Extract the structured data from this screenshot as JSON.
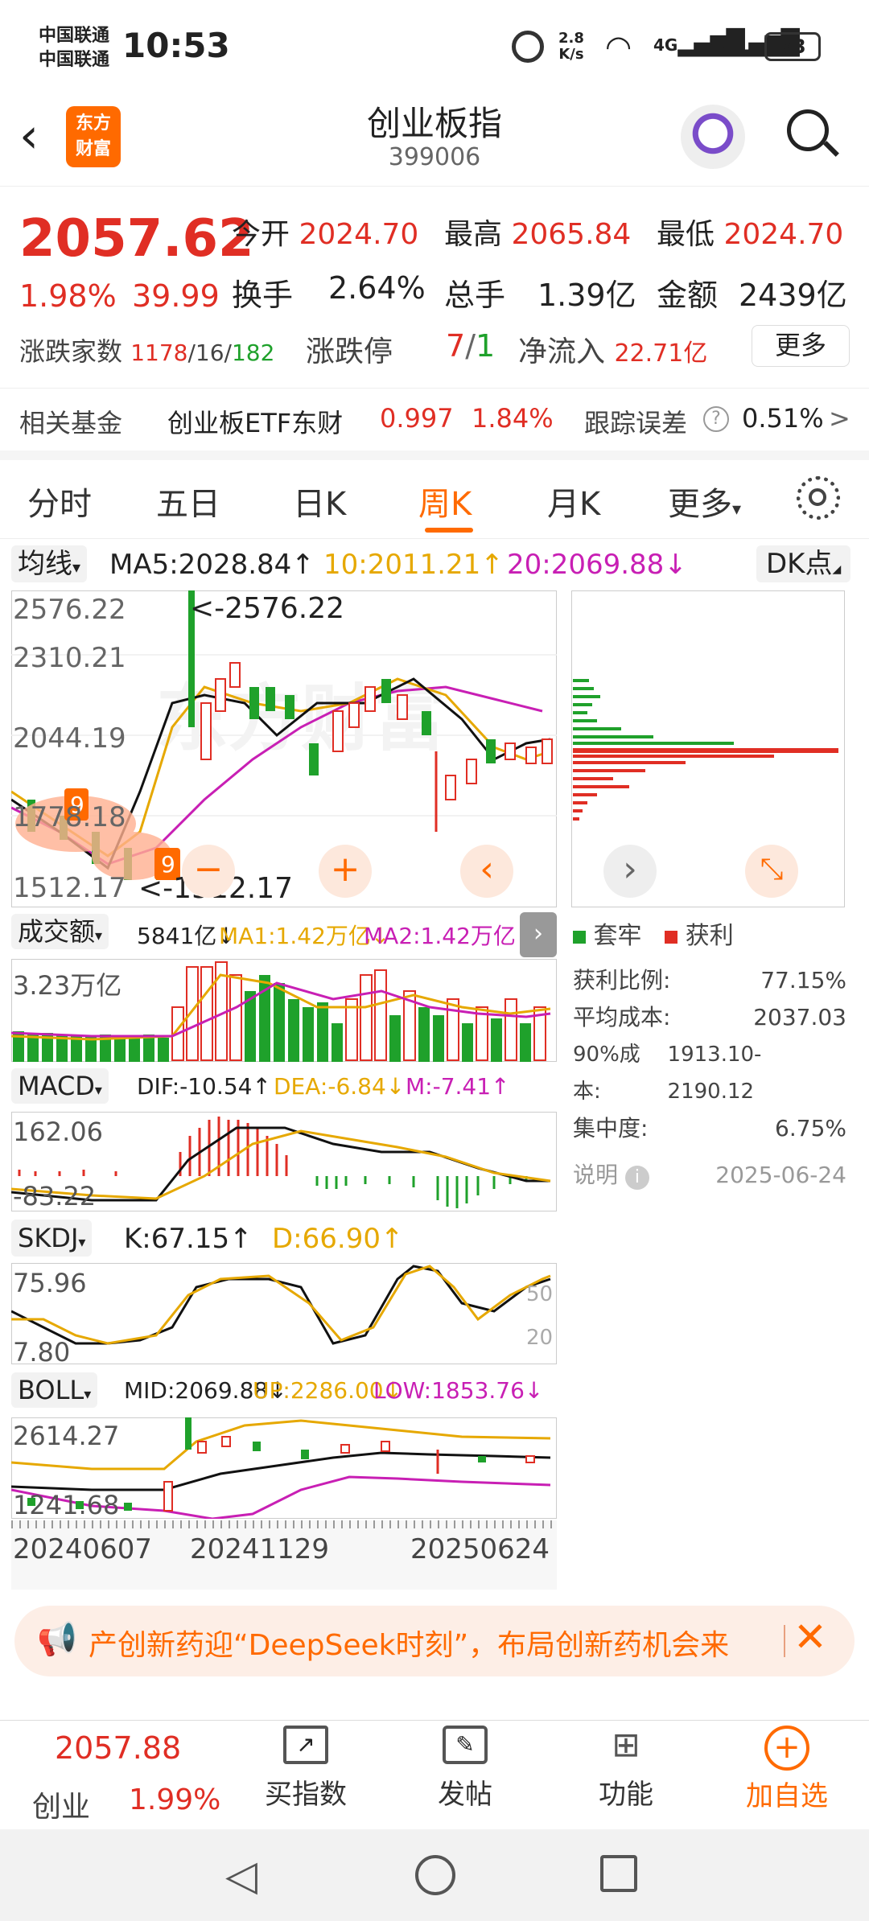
{
  "status": {
    "carrier1": "中国联通",
    "carrier2": "中国联通",
    "time": "10:53",
    "speed": "2.8",
    "speed_unit": "K/s",
    "net1": "4G",
    "net2": "4G",
    "battery": "73"
  },
  "header": {
    "title": "创业板指",
    "code": "399006",
    "logo_line1": "东方",
    "logo_line2": "财富"
  },
  "quote": {
    "price": "2057.62",
    "pct": "1.98%",
    "chg": "39.99",
    "open_label": "今开",
    "open": "2024.70",
    "high_label": "最高",
    "high": "2065.84",
    "low_label": "最低",
    "low": "2024.70",
    "turnover_label": "换手",
    "turnover": "2.64%",
    "vol_label": "总手",
    "vol": "1.39亿",
    "amount_label": "金额",
    "amount": "2439亿",
    "adv_label": "涨跌家数",
    "adv_up": "1178",
    "adv_flat": "16",
    "adv_down": "182",
    "sep": "/",
    "limit_label": "涨跌停",
    "limit_up": "7",
    "limit_down": "1",
    "inflow_label": "净流入",
    "inflow": "22.71亿",
    "more": "更多"
  },
  "fund": {
    "label": "相关基金",
    "name": "创业板ETF东财",
    "price": "0.997",
    "pct": "1.84%",
    "err_label": "跟踪误差",
    "err": "0.51%",
    "arrow": ">"
  },
  "tabs": [
    {
      "label": "分时"
    },
    {
      "label": "五日"
    },
    {
      "label": "日K"
    },
    {
      "label": "周K"
    },
    {
      "label": "月K"
    },
    {
      "label": "更多"
    }
  ],
  "ma": {
    "sel": "均线",
    "ma5": "MA5:2028.84↑",
    "ma10": "10:2011.21↑",
    "ma20": "20:2069.88↓",
    "dk": "DK点"
  },
  "kchart": {
    "y1": "2576.22",
    "y2": "2310.21",
    "y3": "2044.19",
    "y4": "1778.18",
    "y5": "1512.17",
    "hi_note": "<-2576.22",
    "lo_note": "<-1512.17"
  },
  "chips": {
    "tab1": "套牢",
    "tab2": "获利",
    "r1_label": "获利比例:",
    "r1": "77.15%",
    "r2_label": "平均成本:",
    "r2": "2037.03",
    "r3_label": "90%成本:",
    "r3": "1913.10-2190.12",
    "r4_label": "集中度:",
    "r4": "6.75%",
    "note_label": "说明",
    "date": "2025-06-24"
  },
  "vol": {
    "sel": "成交额",
    "v": "5841亿↓",
    "ma1": "MA1:1.42万亿↓",
    "ma2": "MA2:1.42万亿↓",
    "y": "3.23万亿"
  },
  "macd": {
    "sel": "MACD",
    "dif": "DIF:-10.54↑",
    "dea": "DEA:-6.84↓",
    "m": "M:-7.41↑",
    "y1": "162.06",
    "y2": "-83.22"
  },
  "skdj": {
    "sel": "SKDJ",
    "k": "K:67.15↑",
    "d": "D:66.90↑",
    "y1": "75.96",
    "y2": "7.80",
    "r50": "50",
    "r20": "20"
  },
  "boll": {
    "sel": "BOLL",
    "mid": "MID:2069.88↓",
    "up": "UP:2286.00↓",
    "low": "LOW:1853.76↓",
    "y1": "2614.27",
    "y2": "1241.68"
  },
  "xaxis": {
    "d1": "20240607",
    "d2": "20241129",
    "d3": "20250624"
  },
  "banner": {
    "text": "产创新药迎“DeepSeek时刻”，布局创新药机会来"
  },
  "bottom": {
    "price": "2057.88",
    "name": "创业",
    "pct": "1.99%",
    "b1": "买指数",
    "b2": "发帖",
    "b3": "功能",
    "b4": "加自选"
  },
  "colors": {
    "up": "#e02e24",
    "down": "#1fa12b",
    "ma10": "#e6a800",
    "ma20": "#c81fb4",
    "accent": "#ff6a00"
  }
}
